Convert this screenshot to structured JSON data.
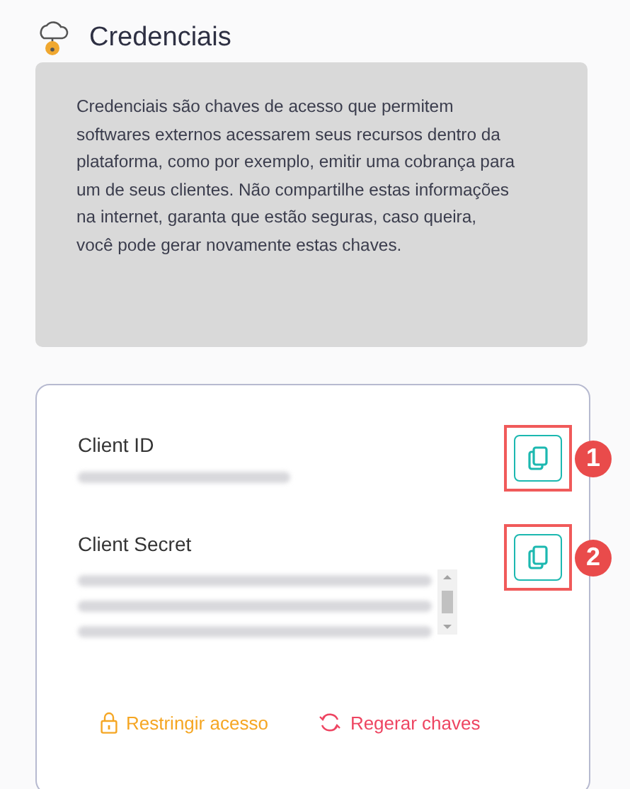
{
  "header": {
    "title": "Credenciais"
  },
  "description": "Credenciais são chaves de acesso que permitem softwares externos acessarem seus recursos dentro da plataforma, como por exemplo, emitir uma cobrança para um de seus clientes. Não compartilhe estas informações na internet, garanta que estão seguras, caso queira, você pode gerar novamente estas chaves.",
  "fields": [
    {
      "kind": "single",
      "label": "Client ID",
      "callout": "1"
    },
    {
      "kind": "multi",
      "label": "Client Secret",
      "callout": "2"
    }
  ],
  "actions": [
    {
      "kind": "lock",
      "label": "Restringir acesso"
    },
    {
      "kind": "refresh",
      "label": "Regerar chaves"
    }
  ]
}
